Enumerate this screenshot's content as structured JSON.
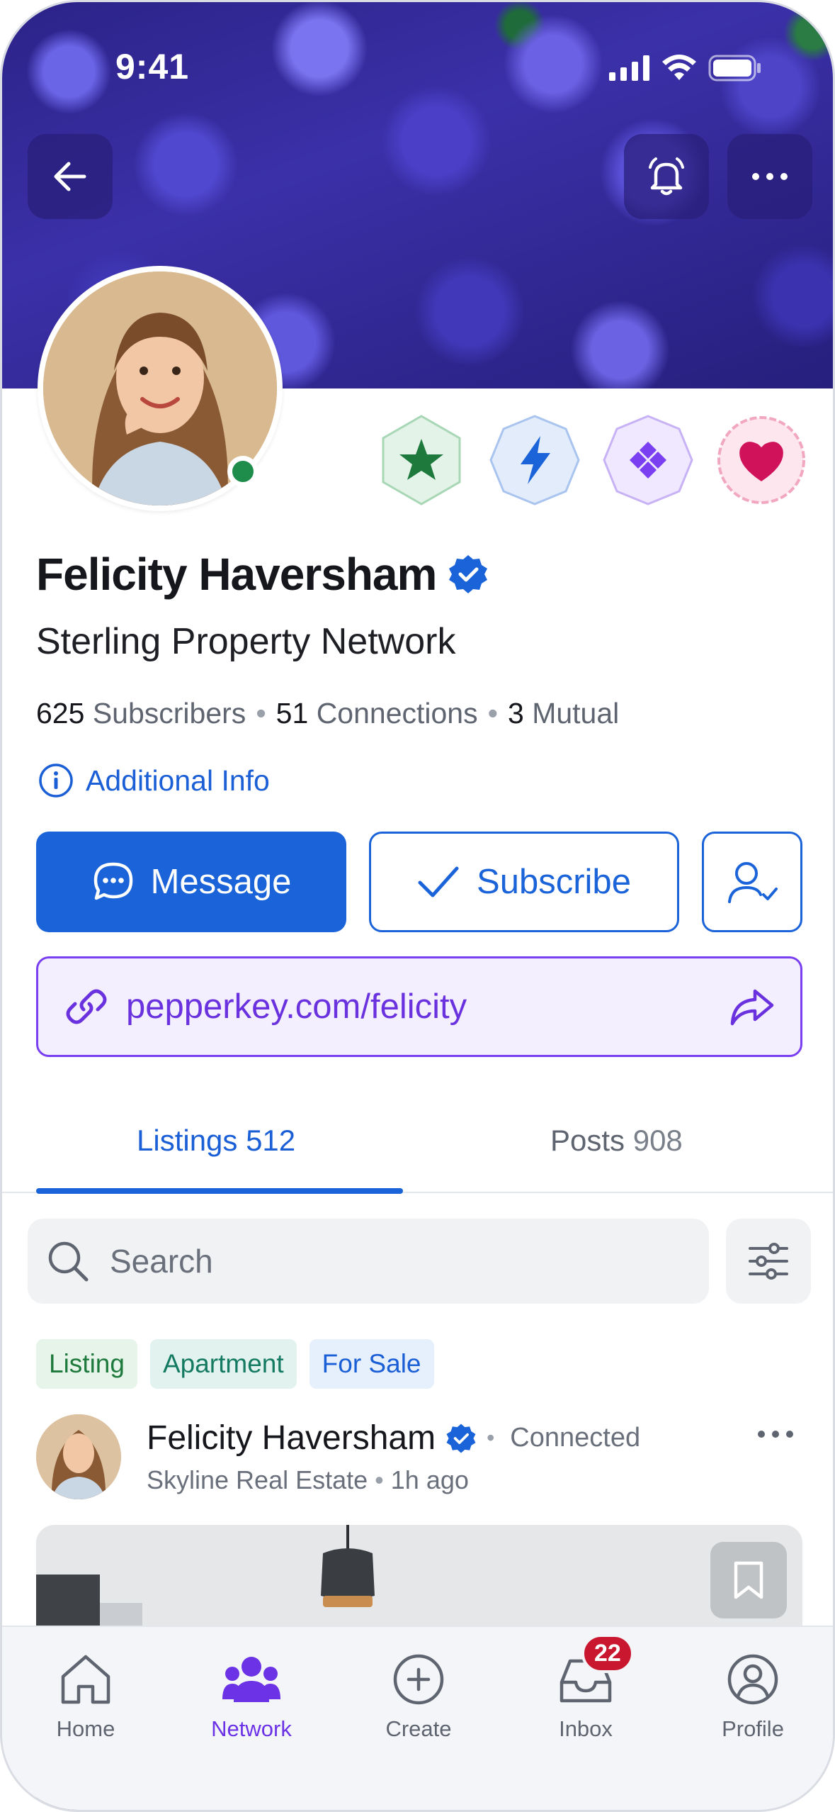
{
  "status_bar": {
    "time": "9:41"
  },
  "profile": {
    "name": "Felicity Haversham",
    "company": "Sterling Property Network",
    "stats": {
      "subscribers_count": "625",
      "subscribers_label": "Subscribers",
      "connections_count": "51",
      "connections_label": "Connections",
      "mutual_count": "3",
      "mutual_label": "Mutual"
    },
    "additional_info_label": "Additional Info"
  },
  "actions": {
    "message_label": "Message",
    "subscribe_label": "Subscribe",
    "profile_link": "pepperkey.com/felicity"
  },
  "badges": [
    {
      "icon": "star-icon",
      "color": "#1e7a3c",
      "bg": "#e4f3e8"
    },
    {
      "icon": "lightning-icon",
      "color": "#1a63d9",
      "bg": "#e3ecfb"
    },
    {
      "icon": "diamond-icon",
      "color": "#7a3ff0",
      "bg": "#efe8ff"
    },
    {
      "icon": "heart-icon",
      "color": "#d0125a",
      "bg": "#fde6ee"
    }
  ],
  "tabs": [
    {
      "label": "Listings",
      "count": "512",
      "active": true
    },
    {
      "label": "Posts",
      "count": "908",
      "active": false
    }
  ],
  "search": {
    "placeholder": "Search"
  },
  "chips": [
    "Listing",
    "Apartment",
    "For Sale"
  ],
  "post": {
    "author": "Felicity Haversham",
    "connection_status": "Connected",
    "company": "Skyline Real Estate",
    "time": "1h ago"
  },
  "bottom_nav": {
    "items": [
      {
        "label": "Home",
        "icon": "home-icon"
      },
      {
        "label": "Network",
        "icon": "network-icon",
        "active": true
      },
      {
        "label": "Create",
        "icon": "plus-circle-icon"
      },
      {
        "label": "Inbox",
        "icon": "inbox-icon",
        "badge": "22"
      },
      {
        "label": "Profile",
        "icon": "profile-icon"
      }
    ]
  },
  "colors": {
    "accent_blue": "#1a63d9",
    "accent_purple": "#6b32e6",
    "badge_red": "#c8172e",
    "online_green": "#1e8c4a"
  }
}
